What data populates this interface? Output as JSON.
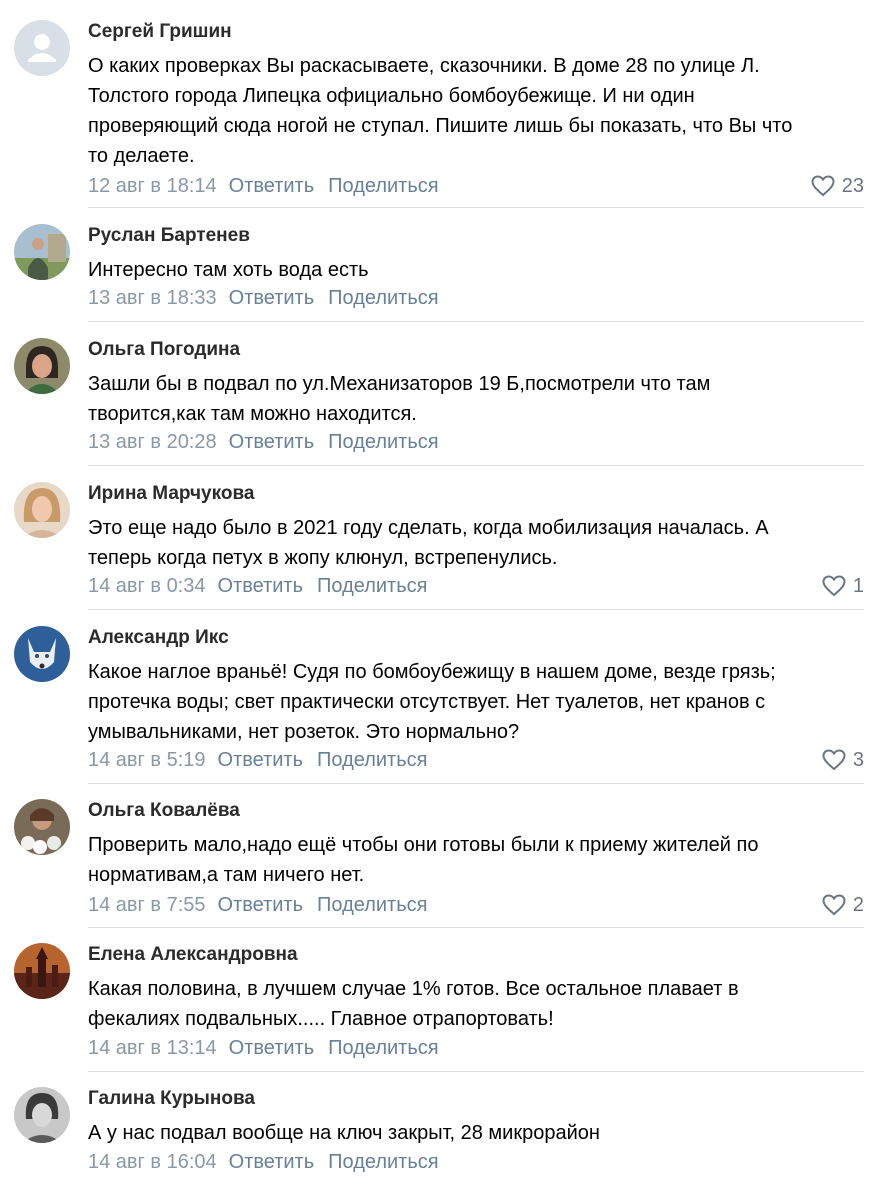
{
  "comments": [
    {
      "author": "Сергей Гришин",
      "text": "О каких проверках Вы раскасываете, сказочники. В доме 28 по улице Л.\nТолстого города Липецка официально бомбоубежище. И ни один\nпроверяющий сюда ногой не ступал. Пишите лишь бы показать, что Вы что\nто делаете.",
      "date": "12 авг в 18:14",
      "reply_label": "Ответить",
      "share_label": "Поделиться",
      "likes": "23",
      "avatar": "default-person-icon"
    },
    {
      "author": "Руслан Бартенев",
      "text": "Интересно там хоть вода есть",
      "date": "13 авг в 18:33",
      "reply_label": "Ответить",
      "share_label": "Поделиться",
      "avatar": "photo-man-outdoors"
    },
    {
      "author": "Ольга Погодина",
      "text": "Зашли бы в подвал по ул.Механизаторов 19 Б,посмотрели что там\nтворится,как там можно находится.",
      "date": "13 авг в 20:28",
      "reply_label": "Ответить",
      "share_label": "Поделиться",
      "avatar": "photo-woman-dark-hair"
    },
    {
      "author": "Ирина Марчукова",
      "text": "Это еще надо было в 2021 году сделать, когда мобилизация началась. А\nтеперь когда петух в жопу клюнул, встрепенулись.",
      "date": "14 авг в 0:34",
      "reply_label": "Ответить",
      "share_label": "Поделиться",
      "likes": "1",
      "avatar": "photo-woman-blonde"
    },
    {
      "author": "Александр Икс",
      "text": "Какое наглое враньё! Судя по бомбоубежищу в нашем доме, везде грязь;\nпротечка воды; свет практически отсутствует. Нет туалетов, нет кранов с\nумывальниками, нет розеток. Это нормально?",
      "date": "14 авг в 5:19",
      "reply_label": "Ответить",
      "share_label": "Поделиться",
      "likes": "3",
      "avatar": "photo-white-wolf"
    },
    {
      "author": "Ольга Ковалёва",
      "text": "Проверить мало,надо ещё чтобы они готовы были к приему жителей по\nнормативам,а там ничего нет.",
      "date": "14 авг в 7:55",
      "reply_label": "Ответить",
      "share_label": "Поделиться",
      "likes": "2",
      "avatar": "photo-woman-flowers"
    },
    {
      "author": "Елена Александровна",
      "text": "Какая половина, в лучшем случае 1% готов. Все остальное плавает в\nфекалиях подвальных..... Главное отрапортовать!",
      "date": "14 авг в 13:14",
      "reply_label": "Ответить",
      "share_label": "Поделиться",
      "avatar": "photo-church-sunset"
    },
    {
      "author": "Галина Курынова",
      "text": "А у нас подвал вообще на ключ закрыт, 28 микрорайон",
      "date": "14 авг в 16:04",
      "reply_label": "Ответить",
      "share_label": "Поделиться",
      "avatar": "photo-woman-bw"
    }
  ],
  "colors": {
    "author": "#2b2b2b",
    "date": "#8b98a8",
    "action_link": "#6a7f98",
    "likes": "#6c7480",
    "divider": "#dbdde1",
    "default_avatar_bg": "#d9dfe6"
  }
}
